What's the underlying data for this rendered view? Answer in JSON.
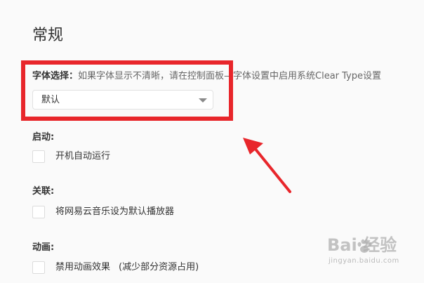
{
  "page": {
    "title": "常规"
  },
  "font_setting": {
    "label": "字体选择：",
    "hint": "如果字体显示不清晰，请在控制面板—字体设置中启用系统Clear Type设置",
    "selected": "默认"
  },
  "sections": {
    "startup": {
      "label": "启动:",
      "option": "开机自动运行"
    },
    "association": {
      "label": "关联:",
      "option": "将网易云音乐设为默认播放器"
    },
    "animation": {
      "label": "动画:",
      "option": "禁用动画效果",
      "note": "(减少部分资源占用)"
    }
  },
  "annotation": {
    "color": "#e8262b"
  },
  "watermark": {
    "brand": "Bai  经验",
    "url": "jingyan.baidu.com"
  }
}
